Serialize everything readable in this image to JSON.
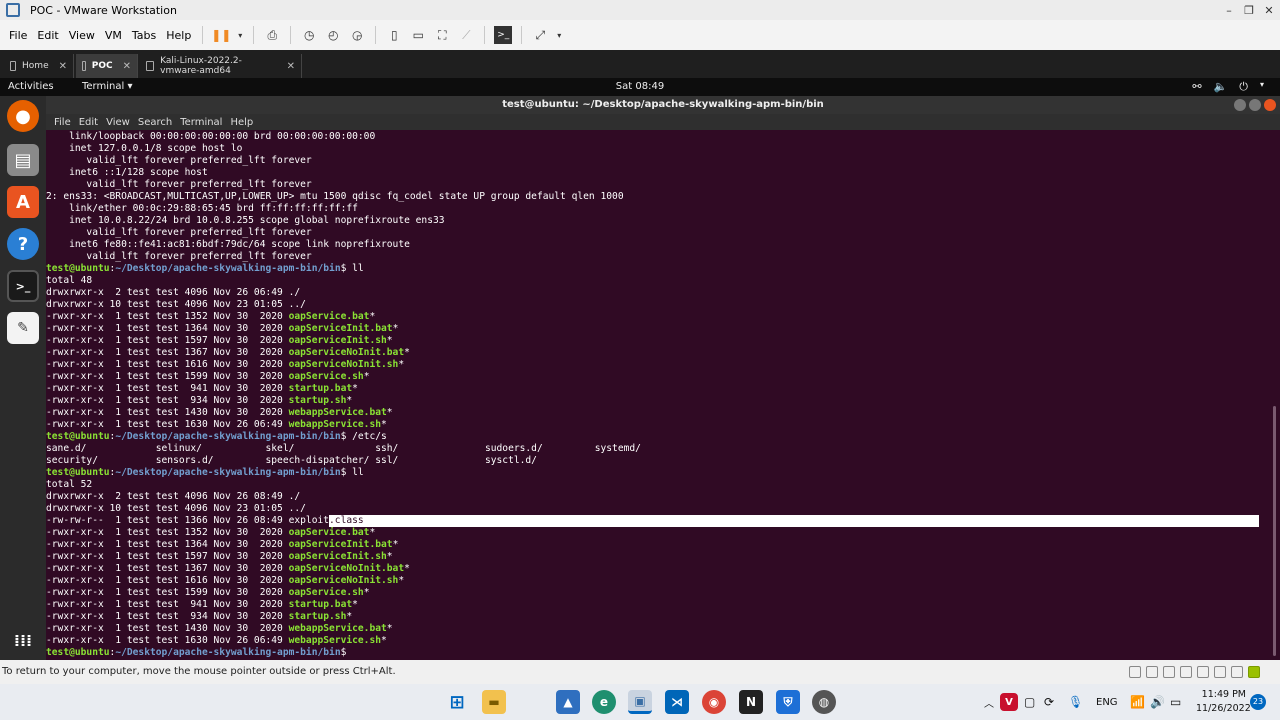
{
  "vmware": {
    "title": "POC - VMware Workstation",
    "menu": [
      "File",
      "Edit",
      "View",
      "VM",
      "Tabs",
      "Help"
    ],
    "tabs": [
      {
        "label": "Home",
        "active": false
      },
      {
        "label": "POC",
        "active": true
      },
      {
        "label": "Kali-Linux-2022.2-vmware-amd64",
        "active": false
      }
    ],
    "status_text": "To return to your computer, move the mouse pointer outside or press Ctrl+Alt."
  },
  "ubuntu": {
    "activities": "Activities",
    "app": "Terminal ▾",
    "clock": "Sat 08:49",
    "dock_icons": [
      "firefox-icon",
      "files-icon",
      "software-icon",
      "help-icon",
      "terminal-icon",
      "text-editor-icon",
      "show-apps-icon"
    ]
  },
  "terminal": {
    "title": "test@ubuntu: ~/Desktop/apache-skywalking-apm-bin/bin",
    "menu": [
      "File",
      "Edit",
      "View",
      "Search",
      "Terminal",
      "Help"
    ],
    "prompt_user": "test@ubuntu",
    "prompt_path": "~/Desktop/apache-skywalking-apm-bin/bin",
    "lines": [
      {
        "t": "plain",
        "text": "    link/loopback 00:00:00:00:00:00 brd 00:00:00:00:00:00"
      },
      {
        "t": "plain",
        "text": "    inet 127.0.0.1/8 scope host lo"
      },
      {
        "t": "plain",
        "text": "       valid_lft forever preferred_lft forever"
      },
      {
        "t": "plain",
        "text": "    inet6 ::1/128 scope host"
      },
      {
        "t": "plain",
        "text": "       valid_lft forever preferred_lft forever"
      },
      {
        "t": "plain",
        "text": "2: ens33: <BROADCAST,MULTICAST,UP,LOWER_UP> mtu 1500 qdisc fq_codel state UP group default qlen 1000"
      },
      {
        "t": "plain",
        "text": "    link/ether 00:0c:29:88:65:45 brd ff:ff:ff:ff:ff:ff"
      },
      {
        "t": "plain",
        "text": "    inet 10.0.8.22/24 brd 10.0.8.255 scope global noprefixroute ens33"
      },
      {
        "t": "plain",
        "text": "       valid_lft forever preferred_lft forever"
      },
      {
        "t": "plain",
        "text": "    inet6 fe80::fe41:ac81:6bdf:79dc/64 scope link noprefixroute"
      },
      {
        "t": "plain",
        "text": "       valid_lft forever preferred_lft forever"
      },
      {
        "t": "prompt",
        "cmd": " ll"
      },
      {
        "t": "plain",
        "text": "total 48"
      },
      {
        "t": "dir",
        "meta": "drwxrwxr-x  2 test test 4096 Nov 26 06:49 ",
        "name": "./"
      },
      {
        "t": "dir",
        "meta": "drwxrwxr-x 10 test test 4096 Nov 23 01:05 ",
        "name": "../"
      },
      {
        "t": "exe",
        "meta": "-rwxr-xr-x  1 test test 1352 Nov 30  2020 ",
        "name": "oapService.bat",
        "suffix": "*"
      },
      {
        "t": "exe",
        "meta": "-rwxr-xr-x  1 test test 1364 Nov 30  2020 ",
        "name": "oapServiceInit.bat",
        "suffix": "*"
      },
      {
        "t": "exe",
        "meta": "-rwxr-xr-x  1 test test 1597 Nov 30  2020 ",
        "name": "oapServiceInit.sh",
        "suffix": "*"
      },
      {
        "t": "exe",
        "meta": "-rwxr-xr-x  1 test test 1367 Nov 30  2020 ",
        "name": "oapServiceNoInit.bat",
        "suffix": "*"
      },
      {
        "t": "exe",
        "meta": "-rwxr-xr-x  1 test test 1616 Nov 30  2020 ",
        "name": "oapServiceNoInit.sh",
        "suffix": "*"
      },
      {
        "t": "exe",
        "meta": "-rwxr-xr-x  1 test test 1599 Nov 30  2020 ",
        "name": "oapService.sh",
        "suffix": "*"
      },
      {
        "t": "exe",
        "meta": "-rwxr-xr-x  1 test test  941 Nov 30  2020 ",
        "name": "startup.bat",
        "suffix": "*"
      },
      {
        "t": "exe",
        "meta": "-rwxr-xr-x  1 test test  934 Nov 30  2020 ",
        "name": "startup.sh",
        "suffix": "*"
      },
      {
        "t": "exe",
        "meta": "-rwxr-xr-x  1 test test 1430 Nov 30  2020 ",
        "name": "webappService.bat",
        "suffix": "*"
      },
      {
        "t": "exe",
        "meta": "-rwxr-xr-x  1 test test 1630 Nov 26 06:49 ",
        "name": "webappService.sh",
        "suffix": "*"
      },
      {
        "t": "prompt",
        "cmd": " /etc/s"
      },
      {
        "t": "plain",
        "text": "sane.d/            selinux/           skel/              ssh/               sudoers.d/         systemd/"
      },
      {
        "t": "plain",
        "text": "security/          sensors.d/         speech-dispatcher/ ssl/               sysctl.d/"
      },
      {
        "t": "prompt",
        "cmd": " ll"
      },
      {
        "t": "plain",
        "text": "total 52"
      },
      {
        "t": "dir",
        "meta": "drwxrwxr-x  2 test test 4096 Nov 26 08:49 ",
        "name": "./"
      },
      {
        "t": "dir",
        "meta": "drwxrwxr-x 10 test test 4096 Nov 23 01:05 ",
        "name": "../"
      },
      {
        "t": "sel",
        "meta": "-rw-rw-r--  1 test test 1366 Nov 26 08:49 ",
        "pre": "exploit",
        "name": ".class"
      },
      {
        "t": "exe",
        "meta": "-rwxr-xr-x  1 test test 1352 Nov 30  2020 ",
        "name": "oapService.bat",
        "suffix": "*"
      },
      {
        "t": "exe",
        "meta": "-rwxr-xr-x  1 test test 1364 Nov 30  2020 ",
        "name": "oapServiceInit.bat",
        "suffix": "*"
      },
      {
        "t": "exe",
        "meta": "-rwxr-xr-x  1 test test 1597 Nov 30  2020 ",
        "name": "oapServiceInit.sh",
        "suffix": "*"
      },
      {
        "t": "exe",
        "meta": "-rwxr-xr-x  1 test test 1367 Nov 30  2020 ",
        "name": "oapServiceNoInit.bat",
        "suffix": "*"
      },
      {
        "t": "exe",
        "meta": "-rwxr-xr-x  1 test test 1616 Nov 30  2020 ",
        "name": "oapServiceNoInit.sh",
        "suffix": "*"
      },
      {
        "t": "exe",
        "meta": "-rwxr-xr-x  1 test test 1599 Nov 30  2020 ",
        "name": "oapService.sh",
        "suffix": "*"
      },
      {
        "t": "exe",
        "meta": "-rwxr-xr-x  1 test test  941 Nov 30  2020 ",
        "name": "startup.bat",
        "suffix": "*"
      },
      {
        "t": "exe",
        "meta": "-rwxr-xr-x  1 test test  934 Nov 30  2020 ",
        "name": "startup.sh",
        "suffix": "*"
      },
      {
        "t": "exe",
        "meta": "-rwxr-xr-x  1 test test 1430 Nov 30  2020 ",
        "name": "webappService.bat",
        "suffix": "*"
      },
      {
        "t": "exe",
        "meta": "-rwxr-xr-x  1 test test 1630 Nov 26 06:49 ",
        "name": "webappService.sh",
        "suffix": "*"
      },
      {
        "t": "prompt",
        "cmd": ""
      }
    ]
  },
  "taskbar": {
    "lang": "ENG",
    "time": "11:49 PM",
    "date": "11/26/2022",
    "notification_count": "23"
  },
  "colors": {
    "terminal_bg": "#300a24",
    "prompt_user": "#8ae234",
    "prompt_path": "#729fcf",
    "executable": "#8ae234",
    "directory": "#ffffff"
  }
}
